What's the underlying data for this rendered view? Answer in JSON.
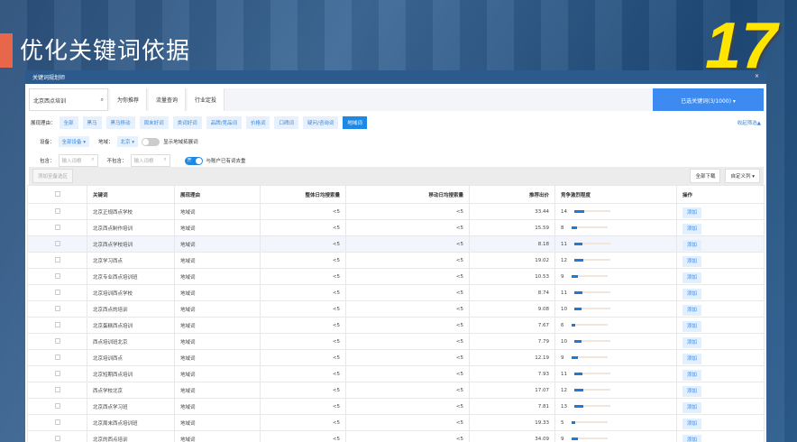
{
  "slide": {
    "title": "优化关键词依据",
    "number": "17"
  },
  "window": {
    "title": "关键词规划师",
    "close": "×"
  },
  "search": {
    "value": "北京西点培训"
  },
  "tabs": [
    "为你推荐",
    "流量查询",
    "行业定投"
  ],
  "selected_button": "已选关键词(3/1000) ▾",
  "filters": {
    "label": "展现理由：",
    "chips": [
      "全部",
      "黑马",
      "黑马移动",
      "周末好词",
      "类词好词",
      "品牌/竞品词",
      "价格词",
      "口碑词",
      "疑问/咨询词",
      "地域词"
    ],
    "active": "地域词",
    "collapse": "收起筛选▲"
  },
  "device": {
    "label": "设备：",
    "value": "全部设备 ▾",
    "region_label": "地域：",
    "region": "北京 ▾",
    "toggle_label": "显示地域拓展词"
  },
  "include": {
    "label": "包含：",
    "placeholder": "输入词根",
    "exclude_label": "不包含：",
    "exclude_placeholder": "输入词根",
    "toggle_text": "开",
    "toggle_label": "与账户已有词去重"
  },
  "toolbar": {
    "add": "添加至备选区",
    "download": "全部下载",
    "custom": "自定义列 ▾"
  },
  "columns": [
    "关键词",
    "展现理由",
    "整体日均搜索量",
    "移动日均搜索量",
    "推荐出价",
    "竞争激烈程度",
    "操作"
  ],
  "rows": [
    [
      "北京正规西点学校",
      "地域词",
      "<5",
      "<5",
      "33.44",
      "14"
    ],
    [
      "北京西点制作培训",
      "地域词",
      "<5",
      "<5",
      "15.59",
      "8"
    ],
    [
      "北京西点学校培训",
      "地域词",
      "<5",
      "<5",
      "8.18",
      "11"
    ],
    [
      "北京学习西点",
      "地域词",
      "<5",
      "<5",
      "19.02",
      "12"
    ],
    [
      "北京专业西点培训班",
      "地域词",
      "<5",
      "<5",
      "10.53",
      "9"
    ],
    [
      "北京培训西点学校",
      "地域词",
      "<5",
      "<5",
      "8.74",
      "11"
    ],
    [
      "北京西点的培训",
      "地域词",
      "<5",
      "<5",
      "9.08",
      "10"
    ],
    [
      "北京蛋糕西点培训",
      "地域词",
      "<5",
      "<5",
      "7.67",
      "6"
    ],
    [
      "西点培训班北京",
      "地域词",
      "<5",
      "<5",
      "7.79",
      "10"
    ],
    [
      "北京培训西点",
      "地域词",
      "<5",
      "<5",
      "12.19",
      "9"
    ],
    [
      "北京短期西点培训",
      "地域词",
      "<5",
      "<5",
      "7.93",
      "11"
    ],
    [
      "西点学校北京",
      "地域词",
      "<5",
      "<5",
      "17.07",
      "12"
    ],
    [
      "北京西点学习班",
      "地域词",
      "<5",
      "<5",
      "7.81",
      "13"
    ],
    [
      "北京周末西点培训班",
      "地域词",
      "<5",
      "<5",
      "19.33",
      "5"
    ],
    [
      "北京的西点培训",
      "地域词",
      "<5",
      "<5",
      "34.09",
      "9"
    ]
  ],
  "add_label": "添加"
}
